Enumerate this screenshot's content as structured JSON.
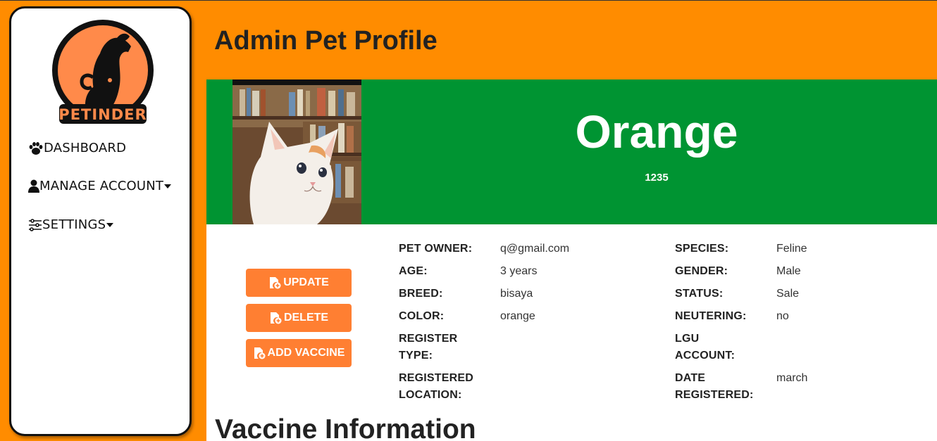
{
  "app": {
    "brand": "PETINDER"
  },
  "sidebar": {
    "items": [
      {
        "label": "DASHBOARD",
        "icon": "paw-icon"
      },
      {
        "label": "MANAGE ACCOUNT",
        "icon": "user-icon",
        "has_dropdown": true
      },
      {
        "label": "SETTINGS",
        "icon": "sliders-icon",
        "has_dropdown": true
      }
    ]
  },
  "header": {
    "title": "Admin Pet Profile"
  },
  "pet": {
    "name": "Orange",
    "id": "1235"
  },
  "actions": {
    "update": "UPDATE",
    "delete": "DELETE",
    "add_vaccine": "ADD VACCINE"
  },
  "details": {
    "left": [
      {
        "label": "PET OWNER:",
        "value": "q@gmail.com"
      },
      {
        "label": "AGE:",
        "value": "3 years"
      },
      {
        "label": "BREED:",
        "value": "bisaya"
      },
      {
        "label": "COLOR:",
        "value": "orange"
      },
      {
        "label": "REGISTER TYPE:",
        "value": ""
      },
      {
        "label": "REGISTERED LOCATION:",
        "value": ""
      }
    ],
    "right": [
      {
        "label": "SPECIES:",
        "value": "Feline"
      },
      {
        "label": "GENDER:",
        "value": "Male"
      },
      {
        "label": "STATUS:",
        "value": "Sale"
      },
      {
        "label": "NEUTERING:",
        "value": "no"
      },
      {
        "label": "LGU ACCOUNT:",
        "value": ""
      },
      {
        "label": "DATE REGISTERED:",
        "value": "march"
      }
    ]
  },
  "vaccine": {
    "section_title": "Vaccine Information"
  },
  "colors": {
    "header_bg": "#ff8c00",
    "banner_bg": "#009432",
    "button_bg": "#ff7f32",
    "sidebar_bg": "#ffffff"
  }
}
